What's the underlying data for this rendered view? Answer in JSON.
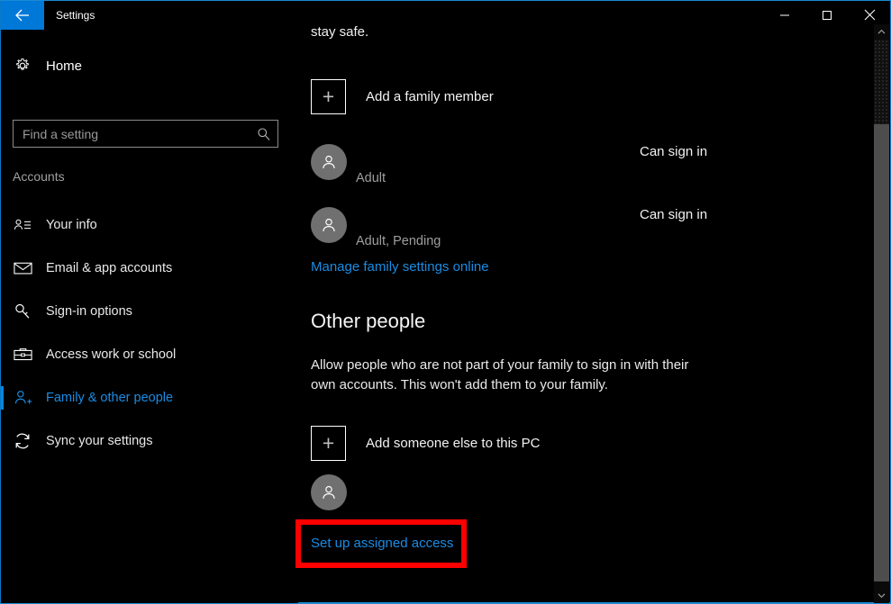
{
  "window": {
    "title": "Settings",
    "back_icon": "back-arrow-icon",
    "controls": {
      "minimize": "minimize-icon",
      "maximize": "maximize-icon",
      "close": "close-icon"
    },
    "accent_color": "#0078d7",
    "background_color": "#000000"
  },
  "sidebar": {
    "home": {
      "label": "Home",
      "icon": "gear-icon"
    },
    "search": {
      "placeholder": "Find a setting",
      "value": "",
      "icon": "search-icon"
    },
    "section_label": "Accounts",
    "items": [
      {
        "label": "Your info",
        "icon": "person-card-icon",
        "selected": false
      },
      {
        "label": "Email & app accounts",
        "icon": "envelope-icon",
        "selected": false
      },
      {
        "label": "Sign-in options",
        "icon": "key-icon",
        "selected": false
      },
      {
        "label": "Access work or school",
        "icon": "briefcase-icon",
        "selected": false
      },
      {
        "label": "Family & other people",
        "icon": "person-add-icon",
        "selected": true
      },
      {
        "label": "Sync your settings",
        "icon": "sync-icon",
        "selected": false
      }
    ],
    "selected_color": "#1b8ce3"
  },
  "main": {
    "scrolled_text": "stay safe.",
    "family": {
      "add_member": {
        "label": "Add a family member",
        "icon": "plus-box-icon"
      },
      "members": [
        {
          "avatar": "person-avatar-icon",
          "subtitle": "Adult",
          "status": "Can sign in"
        },
        {
          "avatar": "person-avatar-icon",
          "subtitle": "Adult, Pending",
          "status": "Can sign in"
        }
      ],
      "manage_link": "Manage family settings online"
    },
    "other_people": {
      "heading": "Other people",
      "description": "Allow people who are not part of your family to sign in with their own accounts. This won't add them to your family.",
      "add_someone": {
        "label": "Add someone else to this PC",
        "icon": "plus-box-icon"
      },
      "account": {
        "avatar": "person-avatar-icon"
      },
      "assigned_access_link": "Set up assigned access"
    }
  },
  "annotation": {
    "highlight_color": "#fe0000",
    "target": "Set up assigned access"
  },
  "scrollbar": {
    "up_arrow": "chevron-up-icon",
    "down_arrow": "chevron-down-icon"
  }
}
